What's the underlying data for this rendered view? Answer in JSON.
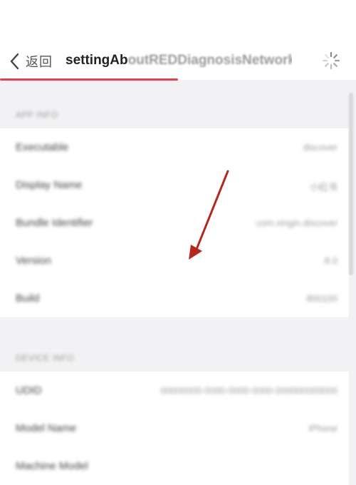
{
  "header": {
    "back_label": "返回",
    "title_clear": "settingAb",
    "title_faded": "outREDDiagnosisNetwork",
    "page_load_progress": 0.5
  },
  "sections": [
    {
      "title": "APP INFO",
      "rows": [
        {
          "label": "Executable",
          "value": "discover"
        },
        {
          "label": "Display Name",
          "value": "小红书"
        },
        {
          "label": "Bundle Identifier",
          "value": "com.xingin.discover"
        },
        {
          "label": "Version",
          "value": "8.0"
        },
        {
          "label": "Build",
          "value": "800100"
        }
      ]
    },
    {
      "title": "DEVICE INFO",
      "rows": [
        {
          "label": "UDID",
          "value": "00000000-0000-0000-0000-000000000000"
        },
        {
          "label": "Model Name",
          "value": "iPhone"
        },
        {
          "label": "Machine Model",
          "value": ""
        }
      ]
    }
  ],
  "annotation": {
    "color": "#b3271f",
    "type": "arrow"
  },
  "colors": {
    "accent": "#e0434f",
    "background": "#f2f2f4"
  }
}
